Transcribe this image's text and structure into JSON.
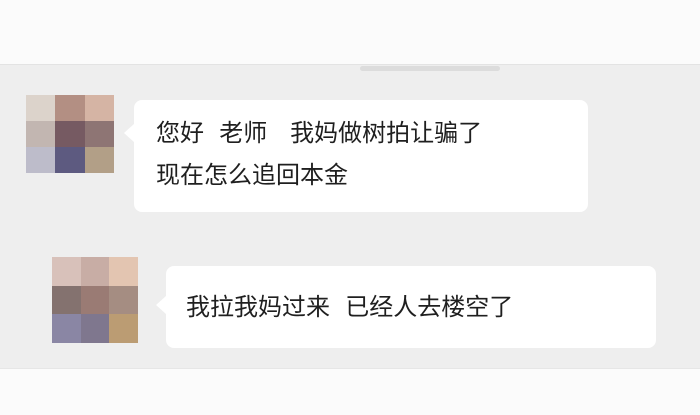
{
  "messages": [
    {
      "lines": [
        "您好  老师   我妈做树拍让骗了",
        "现在怎么追回本金"
      ],
      "avatar_colors": [
        "#dcd3cb",
        "#b38f83",
        "#d5b4a4",
        "#c2b6b1",
        "#765a62",
        "#8e7574",
        "#bdbcca",
        "#5d5a80",
        "#b29f87"
      ]
    },
    {
      "lines": [
        "我拉我妈过来  已经人去楼空了"
      ],
      "avatar_colors": [
        "#d8c1ba",
        "#c8ada5",
        "#e3c5b1",
        "#84726f",
        "#9a7b74",
        "#a58d82",
        "#8a86a4",
        "#7f778e",
        "#bb9c73"
      ]
    }
  ]
}
